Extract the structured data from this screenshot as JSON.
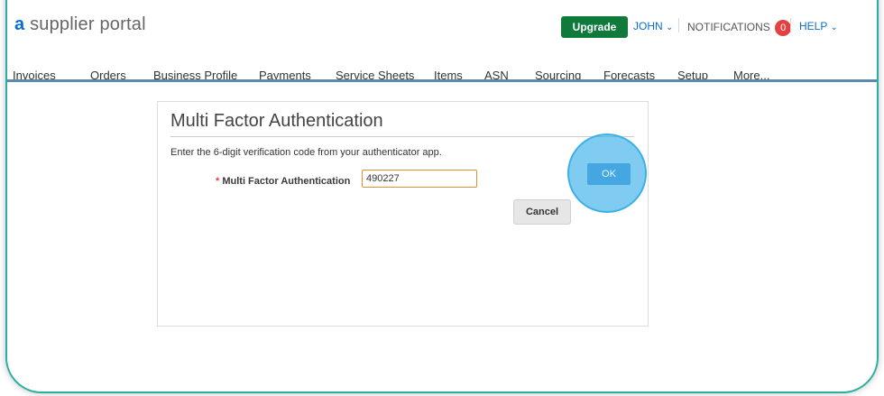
{
  "header": {
    "brand_mark": "a",
    "brand_text": " supplier portal",
    "upgrade_label": "Upgrade",
    "user_label": "JOHN",
    "notifications_label": "NOTIFICATIONS",
    "notifications_count": "0",
    "help_label": "HELP",
    "chevron": "⌄"
  },
  "nav": {
    "tabs": [
      "Invoices",
      "Orders",
      "Business Profile",
      "Payments",
      "Service Sheets",
      "Items",
      "ASN",
      "Sourcing",
      "Forecasts",
      "Setup",
      "More..."
    ]
  },
  "mfa": {
    "title": "Multi Factor Authentication",
    "hint": "Enter the 6-digit verification code from your authenticator app.",
    "required_mark": "*",
    "field_label": "Multi Factor Authentication",
    "field_value": "490227",
    "cancel_label": "Cancel",
    "ok_label": "OK"
  },
  "colors": {
    "frame_accent": "#2ab0a2",
    "upgrade_bg": "#0f7a3c",
    "link_blue": "#0a6ed1",
    "badge_red": "#e34242",
    "ok_blue": "#44a7e1"
  }
}
